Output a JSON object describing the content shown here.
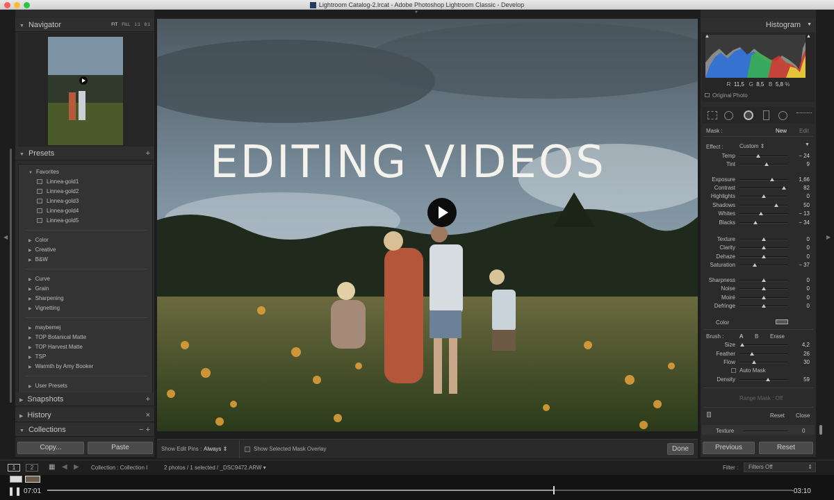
{
  "window": {
    "title": "Lightroom Catalog-2.lrcat - Adobe Photoshop Lightroom Classic - Develop"
  },
  "navigator": {
    "title": "Navigator",
    "zoom_options": [
      "FIT",
      "FILL",
      "1:1",
      "8:1"
    ]
  },
  "presets": {
    "title": "Presets",
    "add_icon": "plus-icon",
    "favorites": {
      "label": "Favorites",
      "items": [
        "Linnea-gold1",
        "Linnea-gold2",
        "Linnea-gold3",
        "Linnea-gold4",
        "Linnea-gold5"
      ]
    },
    "group1": [
      "Color",
      "Creative",
      "B&W"
    ],
    "group2": [
      "Curve",
      "Grain",
      "Sharpening",
      "Vignetting"
    ],
    "group3": [
      "maybemej",
      "TOP Botanical Matte",
      "TOP Harvest Matte",
      "TSP",
      "Warmth by Amy Booker"
    ],
    "user": "User Presets"
  },
  "snapshots": {
    "title": "Snapshots",
    "action": "+"
  },
  "history": {
    "title": "History",
    "action": "×"
  },
  "collections": {
    "title": "Collections",
    "action": "− +"
  },
  "left_buttons": {
    "copy": "Copy...",
    "paste": "Paste"
  },
  "overlay": {
    "headline": "EDITING VIDEOS"
  },
  "toolbar": {
    "edit_pins_label": "Show Edit Pins :",
    "edit_pins_value": "Always",
    "mask_overlay": "Show Selected Mask Overlay",
    "done": "Done"
  },
  "histogram": {
    "title": "Histogram",
    "r_label": "R",
    "r_value": "11,5",
    "g_label": "G",
    "g_value": "8,5",
    "b_label": "B",
    "b_value": "5,8",
    "percent": "%",
    "original_photo": "Original Photo"
  },
  "mask": {
    "label": "Mask :",
    "new": "New",
    "edit": "Edit"
  },
  "effect": {
    "label": "Effect :",
    "value": "Custom"
  },
  "sliders": [
    {
      "name": "Temp",
      "value": "− 24",
      "pos": 0.38
    },
    {
      "name": "Tint",
      "value": "9",
      "pos": 0.55
    },
    {
      "name": "Exposure",
      "value": "1,66",
      "pos": 0.67
    },
    {
      "name": "Contrast",
      "value": "82",
      "pos": 0.91
    },
    {
      "name": "Highlights",
      "value": "0",
      "pos": 0.5
    },
    {
      "name": "Shadows",
      "value": "50",
      "pos": 0.75
    },
    {
      "name": "Whites",
      "value": "− 13",
      "pos": 0.44
    },
    {
      "name": "Blacks",
      "value": "− 34",
      "pos": 0.33
    },
    {
      "name": "Texture",
      "value": "0",
      "pos": 0.5
    },
    {
      "name": "Clarity",
      "value": "0",
      "pos": 0.5
    },
    {
      "name": "Dehaze",
      "value": "0",
      "pos": 0.5
    },
    {
      "name": "Saturation",
      "value": "− 37",
      "pos": 0.32
    },
    {
      "name": "Sharpness",
      "value": "0",
      "pos": 0.5
    },
    {
      "name": "Noise",
      "value": "0",
      "pos": 0.5
    },
    {
      "name": "Moiré",
      "value": "0",
      "pos": 0.5
    },
    {
      "name": "Defringe",
      "value": "0",
      "pos": 0.5
    }
  ],
  "color": {
    "label": "Color"
  },
  "brush": {
    "label": "Brush :",
    "a": "A",
    "b": "B",
    "erase": "Erase",
    "sliders": [
      {
        "name": "Size",
        "value": "4,2",
        "pos": 0.06
      },
      {
        "name": "Feather",
        "value": "26",
        "pos": 0.26
      },
      {
        "name": "Flow",
        "value": "30",
        "pos": 0.3
      }
    ],
    "auto_mask": "Auto Mask",
    "density": {
      "name": "Density",
      "value": "59",
      "pos": 0.59
    }
  },
  "range_mask": {
    "label": "Range Mask : Off"
  },
  "panel_buttons": {
    "reset": "Reset",
    "close": "Close"
  },
  "texture_peek": {
    "name": "Texture",
    "value": "0"
  },
  "right_buttons": {
    "previous": "Previous",
    "reset": "Reset"
  },
  "filmstrip": {
    "pages": [
      "1",
      "2"
    ],
    "collection": "Collection : Collection I",
    "selection": "2 photos / 1 selected / _DSC9472.ARW",
    "filter_label": "Filter :",
    "filter_value": "Filters Off"
  },
  "video": {
    "elapsed": "07:01",
    "remaining": "−03:10",
    "progress": 0.68
  }
}
